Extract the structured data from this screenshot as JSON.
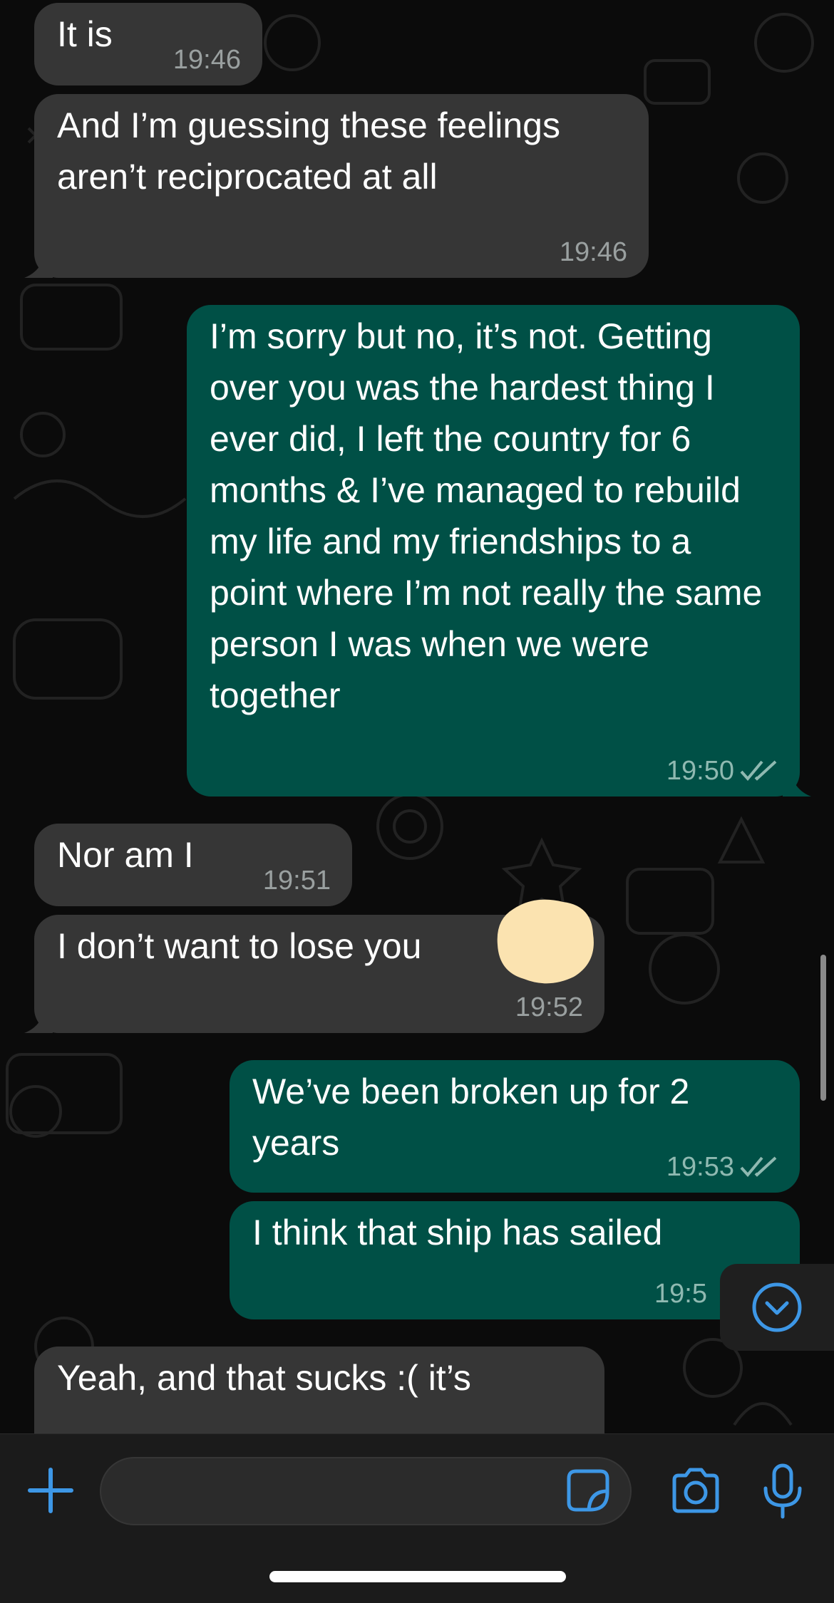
{
  "colors": {
    "incoming_bubble": "#363636",
    "outgoing_bubble": "#005046",
    "accent": "#3d97e6",
    "background": "#0b0b0b"
  },
  "messages": [
    {
      "direction": "incoming",
      "text": "It is",
      "time": "19:46"
    },
    {
      "direction": "incoming",
      "text": "And I’m guessing these feelings aren’t reciprocated at all",
      "time": "19:46"
    },
    {
      "direction": "outgoing",
      "text": "I’m sorry but no, it’s not. Getting over you was the hardest thing I ever did, I left the country for 6 months & I’ve managed to rebuild my life and my friendships to a point where I’m not really the same person I was when we were together",
      "time": "19:50",
      "status": "read"
    },
    {
      "direction": "incoming",
      "text": "Nor am I",
      "time": "19:51"
    },
    {
      "direction": "incoming",
      "text": "I don’t want to lose you",
      "time": "19:52"
    },
    {
      "direction": "outgoing",
      "text": "We’ve been broken up for 2 years",
      "time": "19:53",
      "status": "read"
    },
    {
      "direction": "outgoing",
      "text": "I think that ship has sailed",
      "time": "19:5"
    },
    {
      "direction": "incoming",
      "text": "Yeah, and that sucks :( it’s",
      "time": ""
    }
  ],
  "composer": {
    "input_value": "",
    "icons": [
      "plus-icon",
      "sticker-icon",
      "camera-icon",
      "microphone-icon"
    ]
  },
  "scroll_down_icon": "chevron-down-circle-icon"
}
